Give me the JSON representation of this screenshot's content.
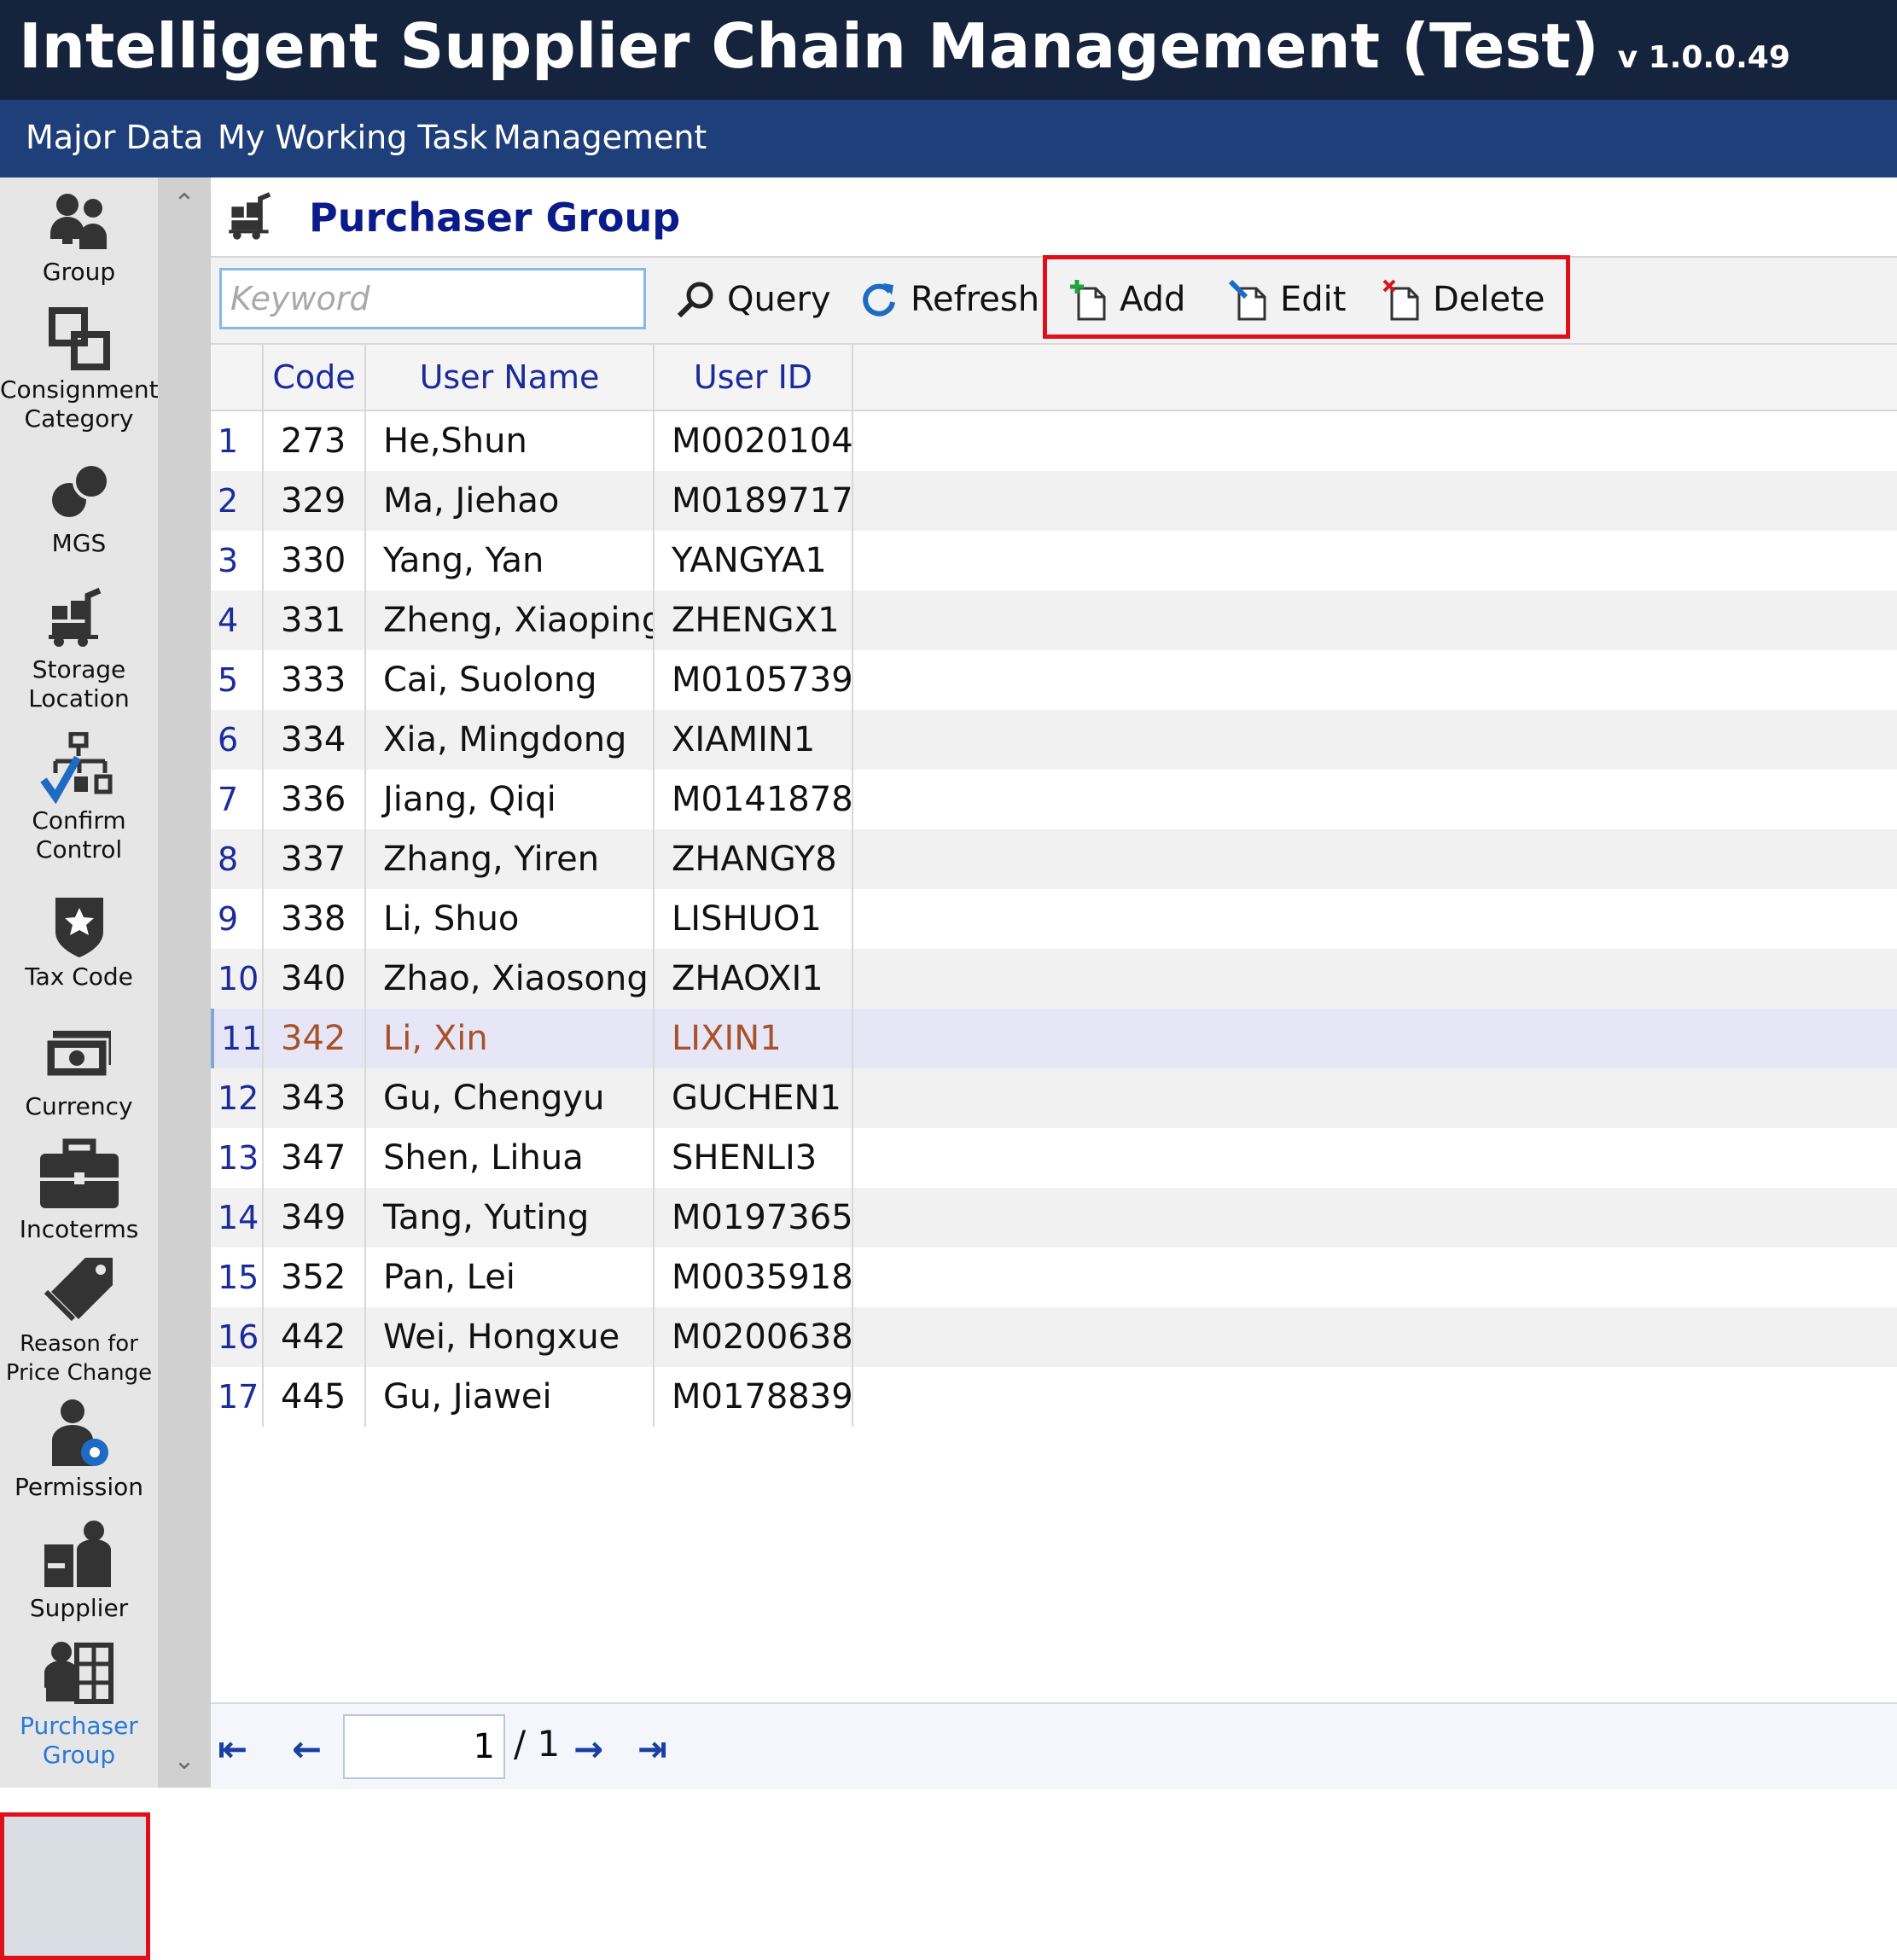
{
  "app": {
    "title": "Intelligent Supplier Chain Management (Test)",
    "version": "v 1.0.0.49"
  },
  "menu": [
    "Major Data",
    "My Working Task",
    "Management"
  ],
  "sidebar": {
    "items": [
      {
        "label": "Group",
        "icon": "group-icon"
      },
      {
        "label": "Consignment Category",
        "icon": "consignment-category-icon"
      },
      {
        "label": "MGS",
        "icon": "mgs-icon"
      },
      {
        "label": "Storage Location",
        "icon": "storage-location-icon"
      },
      {
        "label": "Confirm Control",
        "icon": "confirm-control-icon"
      },
      {
        "label": "Tax Code",
        "icon": "tax-code-icon"
      },
      {
        "label": "Currency",
        "icon": "currency-icon"
      },
      {
        "label": "Incoterms",
        "icon": "incoterms-icon"
      },
      {
        "label": "Reason for Price Change",
        "icon": "price-tag-icon"
      },
      {
        "label": "Permission",
        "icon": "permission-icon"
      },
      {
        "label": "Supplier",
        "icon": "supplier-icon"
      },
      {
        "label": "Purchaser Group",
        "icon": "purchaser-group-icon"
      }
    ],
    "active": "Purchaser Group"
  },
  "page": {
    "title": "Purchaser Group"
  },
  "toolbar": {
    "keyword_placeholder": "Keyword",
    "query_label": "Query",
    "refresh_label": "Refresh",
    "add_label": "Add",
    "edit_label": "Edit",
    "delete_label": "Delete"
  },
  "grid": {
    "columns": [
      "Code",
      "User Name",
      "User ID"
    ],
    "rows": [
      {
        "idx": "1",
        "code": "273",
        "name": "He,Shun",
        "uid": "M0020104"
      },
      {
        "idx": "2",
        "code": "329",
        "name": "Ma, Jiehao",
        "uid": "M0189717"
      },
      {
        "idx": "3",
        "code": "330",
        "name": "Yang, Yan",
        "uid": "YANGYA1"
      },
      {
        "idx": "4",
        "code": "331",
        "name": "Zheng, Xiaoping",
        "uid": "ZHENGX1"
      },
      {
        "idx": "5",
        "code": "333",
        "name": "Cai, Suolong",
        "uid": "M0105739"
      },
      {
        "idx": "6",
        "code": "334",
        "name": "Xia, Mingdong",
        "uid": "XIAMIN1"
      },
      {
        "idx": "7",
        "code": "336",
        "name": "Jiang, Qiqi",
        "uid": "M0141878"
      },
      {
        "idx": "8",
        "code": "337",
        "name": "Zhang, Yiren",
        "uid": "ZHANGY8"
      },
      {
        "idx": "9",
        "code": "338",
        "name": "Li, Shuo",
        "uid": "LISHUO1"
      },
      {
        "idx": "10",
        "code": "340",
        "name": "Zhao, Xiaosong",
        "uid": "ZHAOXI1"
      },
      {
        "idx": "11",
        "code": "342",
        "name": "Li, Xin",
        "uid": "LIXIN1"
      },
      {
        "idx": "12",
        "code": "343",
        "name": "Gu, Chengyu",
        "uid": "GUCHEN1"
      },
      {
        "idx": "13",
        "code": "347",
        "name": "Shen, Lihua",
        "uid": "SHENLI3"
      },
      {
        "idx": "14",
        "code": "349",
        "name": "Tang, Yuting",
        "uid": "M0197365"
      },
      {
        "idx": "15",
        "code": "352",
        "name": "Pan, Lei",
        "uid": "M0035918"
      },
      {
        "idx": "16",
        "code": "442",
        "name": "Wei, Hongxue",
        "uid": "M0200638"
      },
      {
        "idx": "17",
        "code": "445",
        "name": "Gu, Jiawei",
        "uid": "M0178839"
      }
    ],
    "selected_row": "11"
  },
  "pager": {
    "current_page": "1",
    "total_text": "/ 1"
  },
  "colors": {
    "title_bar": "#16233d",
    "menu_bar": "#1f3f7a",
    "highlight_box": "#e0101a",
    "selected_row": "#e6e6f7",
    "selected_text": "#a8512a"
  }
}
